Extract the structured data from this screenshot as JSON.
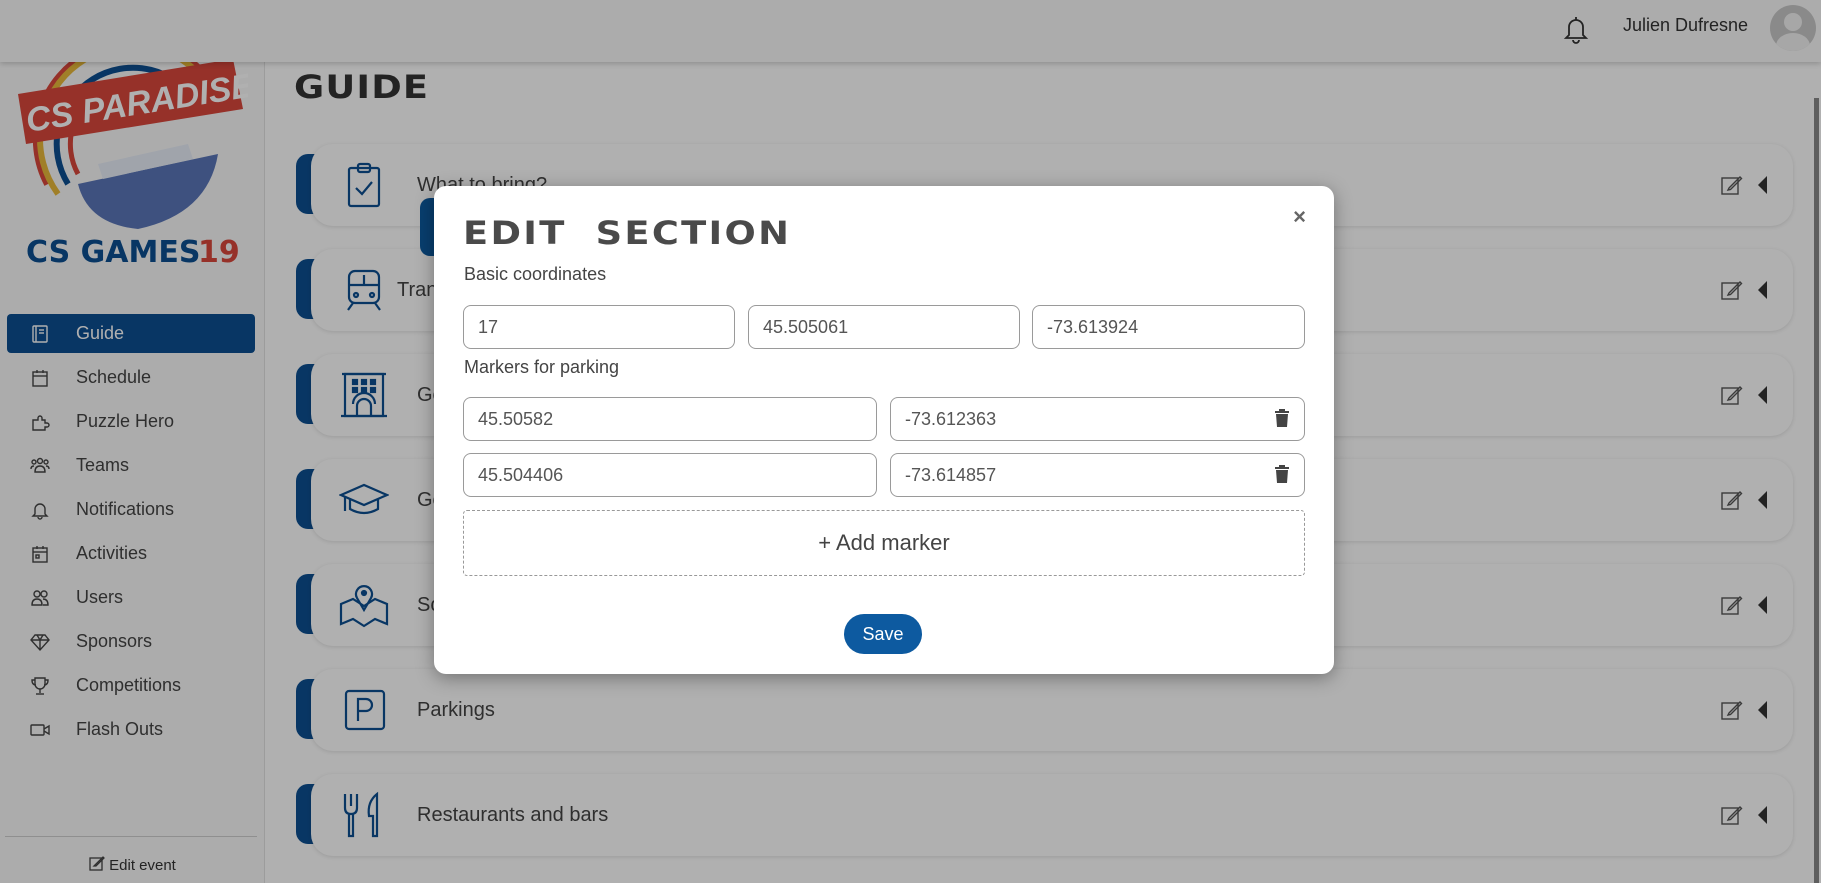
{
  "topbar": {
    "user_name": "Julien Dufresne"
  },
  "logo": {
    "banner_text": "CS PARADISE",
    "brand_text": "CS GAMES",
    "year_text": "19"
  },
  "sidebar": {
    "items": [
      {
        "label": "Guide",
        "icon": "book-icon",
        "active": true
      },
      {
        "label": "Schedule",
        "icon": "calendar-icon"
      },
      {
        "label": "Puzzle Hero",
        "icon": "puzzle-icon"
      },
      {
        "label": "Teams",
        "icon": "team-icon"
      },
      {
        "label": "Notifications",
        "icon": "bell-icon"
      },
      {
        "label": "Activities",
        "icon": "calendar-event-icon"
      },
      {
        "label": "Users",
        "icon": "users-icon"
      },
      {
        "label": "Sponsors",
        "icon": "diamond-icon"
      },
      {
        "label": "Competitions",
        "icon": "trophy-icon"
      },
      {
        "label": "Flash Outs",
        "icon": "video-camera-icon"
      }
    ],
    "edit_event_label": "Edit event"
  },
  "main": {
    "title": "GUIDE",
    "sections": [
      {
        "label": "What to bring?",
        "icon": "clipboard-check-icon"
      },
      {
        "label": "Transport",
        "icon": "train-icon"
      },
      {
        "label": "Ge",
        "icon": "building-icon"
      },
      {
        "label": "Ge",
        "icon": "graduation-cap-icon"
      },
      {
        "label": "Sc",
        "icon": "map-pin-icon"
      },
      {
        "label": "Parkings",
        "icon": "parking-icon"
      },
      {
        "label": "Restaurants and bars",
        "icon": "fork-knife-icon"
      }
    ]
  },
  "modal": {
    "title": "EDIT SECTION",
    "close_label": "×",
    "basic_coordinates_label": "Basic coordinates",
    "basic_coordinates": {
      "zoom": "17",
      "latitude": "45.505061",
      "longitude": "-73.613924"
    },
    "markers_label": "Markers for parking",
    "markers": [
      {
        "latitude": "45.50582",
        "longitude": "-73.612363"
      },
      {
        "latitude": "45.504406",
        "longitude": "-73.614857"
      }
    ],
    "add_marker_label": "+ Add marker",
    "save_label": "Save"
  },
  "colors": {
    "primary": "#0d4f91",
    "button": "#0d5aa0"
  }
}
